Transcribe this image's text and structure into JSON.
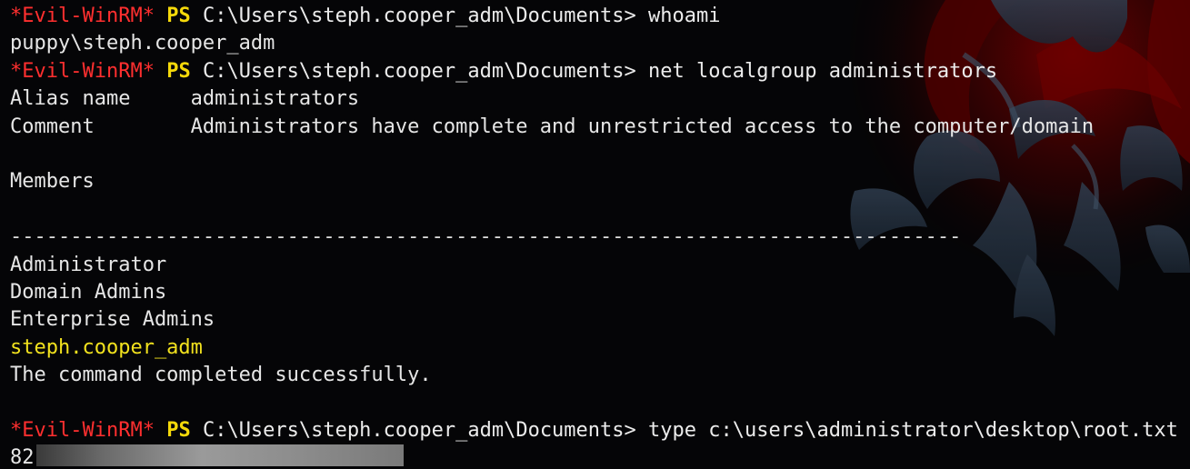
{
  "terminal": {
    "prompt": {
      "tag": "*Evil-WinRM*",
      "ps": "PS",
      "path": "C:\\Users\\steph.cooper_adm\\Documents>"
    },
    "commands": {
      "c1": "whoami",
      "c2": "net localgroup administrators",
      "c3": "type c:\\users\\administrator\\desktop\\root.txt"
    },
    "output": {
      "whoami": "puppy\\steph.cooper_adm",
      "alias_line": "Alias name     administrators",
      "comment_line": "Comment        Administrators have complete and unrestricted access to the computer/domain",
      "members_heading": "Members",
      "separator": "-------------------------------------------------------------------------------",
      "members": [
        "Administrator",
        "Domain Admins",
        "Enterprise Admins",
        "steph.cooper_adm"
      ],
      "completed": "The command completed successfully.",
      "root_hash_prefix": "82"
    },
    "colors": {
      "prompt_tag": "#ff2f2f",
      "prompt_ps": "#f5d90a",
      "highlight_member": "#f2e21e",
      "text": "#e6e6e6",
      "background": "#050507"
    },
    "wallpaper_icon": "ornamental-crest-icon"
  }
}
